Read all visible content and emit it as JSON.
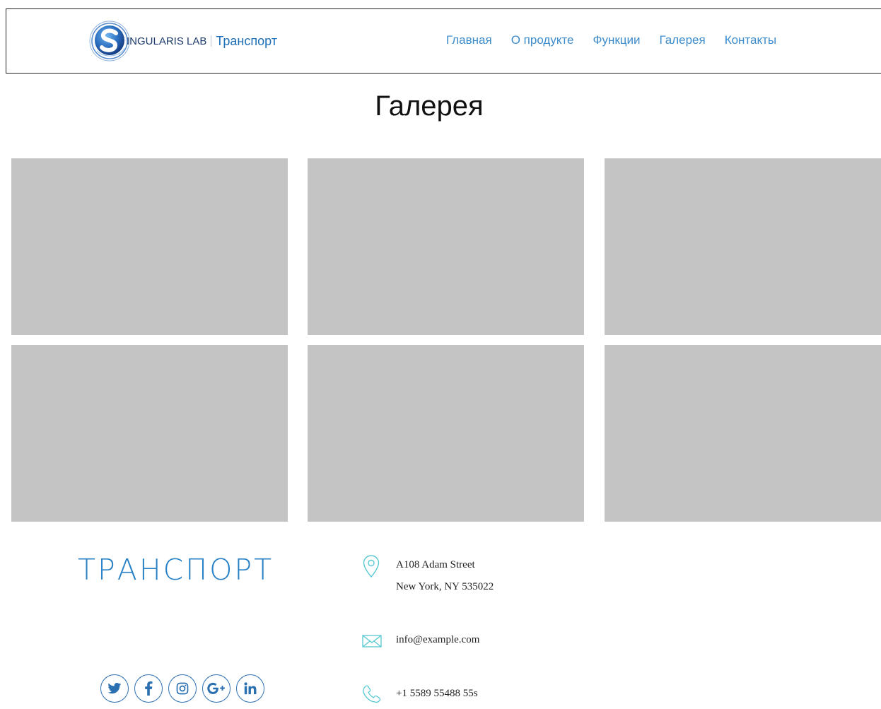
{
  "header": {
    "logo_text": "INGULARIS LAB",
    "logo_sub": "Транспорт",
    "nav": [
      {
        "label": "Главная"
      },
      {
        "label": "О продукте"
      },
      {
        "label": "Функции"
      },
      {
        "label": "Галерея"
      },
      {
        "label": "Контакты"
      }
    ]
  },
  "page": {
    "title": "Галерея"
  },
  "gallery": {
    "tile_color": "#c4c4c4",
    "tiles": 6
  },
  "footer": {
    "brand": "ТРАНСПОРТ",
    "socials": [
      {
        "icon": "twitter-icon"
      },
      {
        "icon": "facebook-icon"
      },
      {
        "icon": "instagram-icon"
      },
      {
        "icon": "google-plus-icon"
      },
      {
        "icon": "linkedin-icon"
      }
    ],
    "address_line1": "A108 Adam Street",
    "address_line2": "New York, NY 535022",
    "email": "info@example.com",
    "phone": "+1 5589 55488 55s"
  },
  "colors": {
    "accent": "#3d8ccc",
    "brand_blue": "#2a82c6",
    "social": "#2a6fb0",
    "icon_teal": "#58c9d1"
  }
}
